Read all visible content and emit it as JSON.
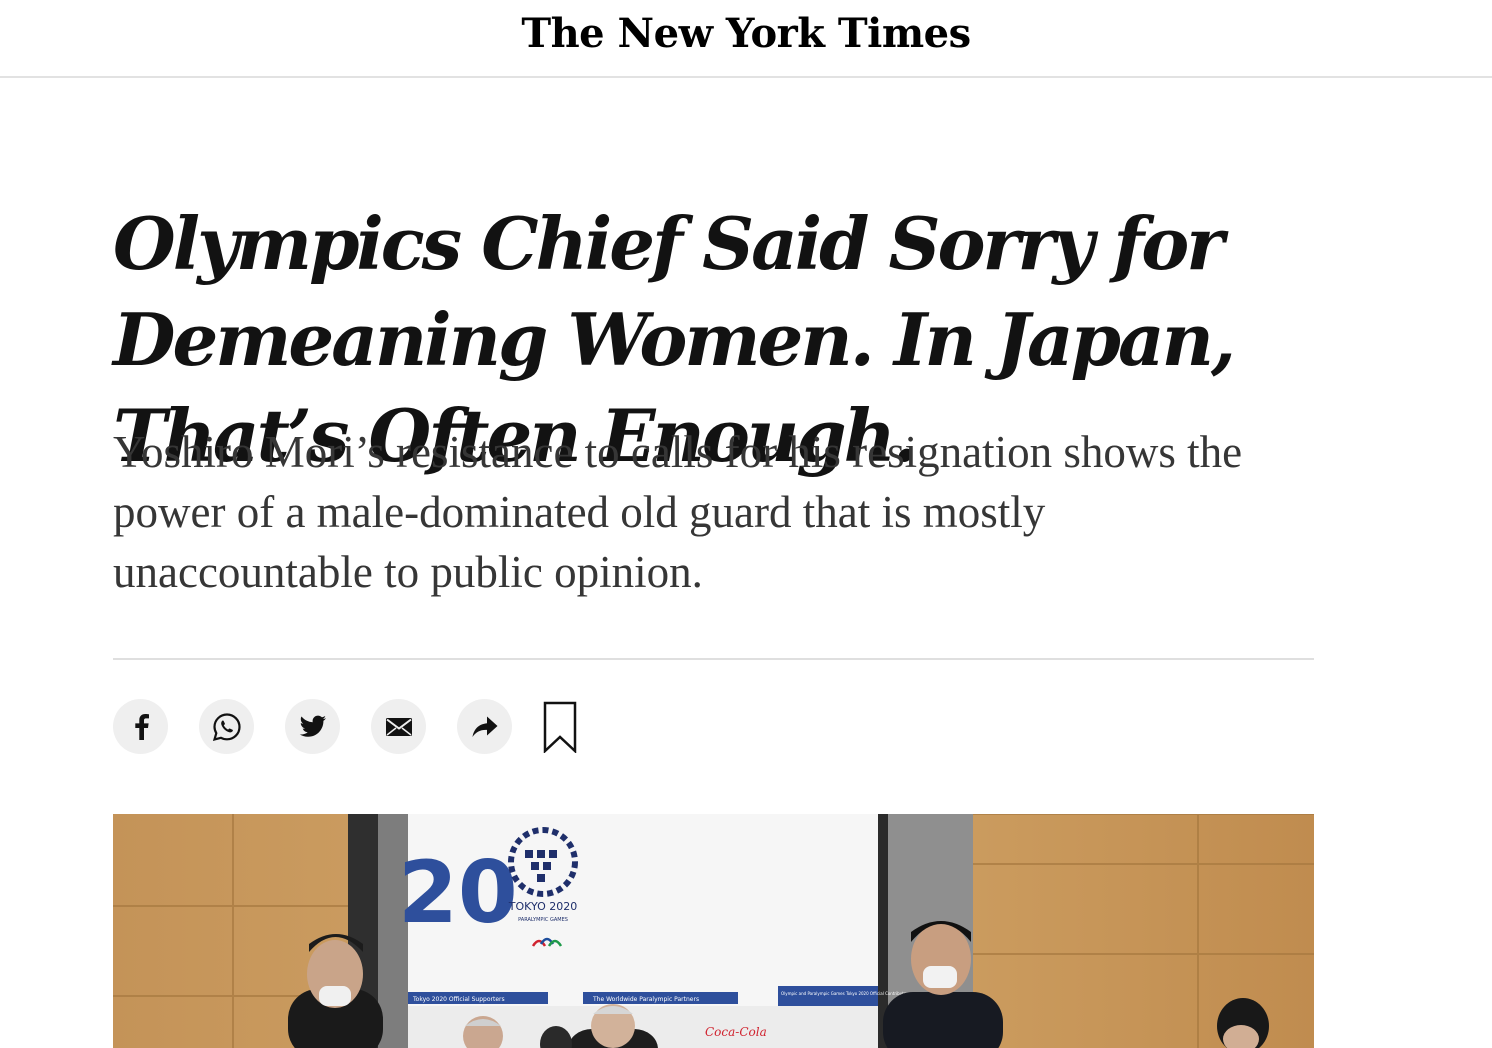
{
  "masthead": {
    "title": "The New York Times"
  },
  "article": {
    "headline": "Olympics Chief Said Sorry for Demeaning Women. In Japan, That’s Often Enough.",
    "summary": "Yoshiro Mori’s resistance to calls for his resignation shows the power of a male-dominated old guard that is mostly unaccountable to public opinion."
  },
  "share_tools": {
    "items": [
      {
        "name": "facebook",
        "icon": "facebook-icon"
      },
      {
        "name": "whatsapp",
        "icon": "whatsapp-icon"
      },
      {
        "name": "twitter",
        "icon": "twitter-icon"
      },
      {
        "name": "email",
        "icon": "email-icon"
      },
      {
        "name": "more-share",
        "icon": "share-arrow-icon"
      }
    ],
    "save_icon": "bookmark-icon"
  },
  "photo": {
    "banner_number": "20",
    "logo_text": "TOKYO 2020",
    "logo_subtext": "PARALYMPIC GAMES",
    "board_labels": [
      "Tokyo 2020 Official Supporters",
      "The Worldwide Paralympic Partners",
      "Olympic and Paralympic Games Tokyo 2020 Official Contributors"
    ],
    "sponsor_text": "Coca-Cola"
  },
  "colors": {
    "text": "#121212",
    "summary_text": "#363636",
    "rule": "#dfdfdf",
    "button_bg": "#efefef",
    "board_blue": "#2e4f9c"
  }
}
